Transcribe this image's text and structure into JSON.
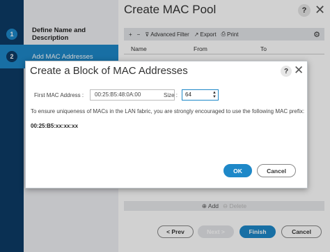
{
  "wizard": {
    "title": "Create MAC Pool",
    "help_icon": "?",
    "close_icon": "✕",
    "steps": [
      {
        "number": "1",
        "label": "Define Name and Description"
      },
      {
        "number": "2",
        "label": "Add MAC Addresses"
      }
    ],
    "toolbar": {
      "add": "+",
      "remove": "−",
      "filter_label": "Advanced Filter",
      "export_label": "Export",
      "print_label": "Print",
      "settings_icon": "⚙"
    },
    "grid_columns": [
      "Name",
      "From",
      "To"
    ],
    "add_row": {
      "add_label": "Add",
      "delete_label": "Delete"
    },
    "buttons": {
      "prev": "< Prev",
      "next": "Next >",
      "finish": "Finish",
      "cancel": "Cancel"
    }
  },
  "modal": {
    "title": "Create a Block of MAC Addresses",
    "help_icon": "?",
    "close_icon": "✕",
    "first_mac_label": "First MAC Address :",
    "first_mac_value": "00:25:B5:48:0A:00",
    "size_label": "Size :",
    "size_value": "64",
    "note": "To ensure uniqueness of MACs in the LAN fabric, you are strongly encouraged to use the following MAC prefix:",
    "prefix": "00:25:B5:xx:xx:xx",
    "ok_label": "OK",
    "cancel_label": "Cancel"
  },
  "colors": {
    "accent": "#1e88c8",
    "nav_dark": "#0d3b66"
  }
}
